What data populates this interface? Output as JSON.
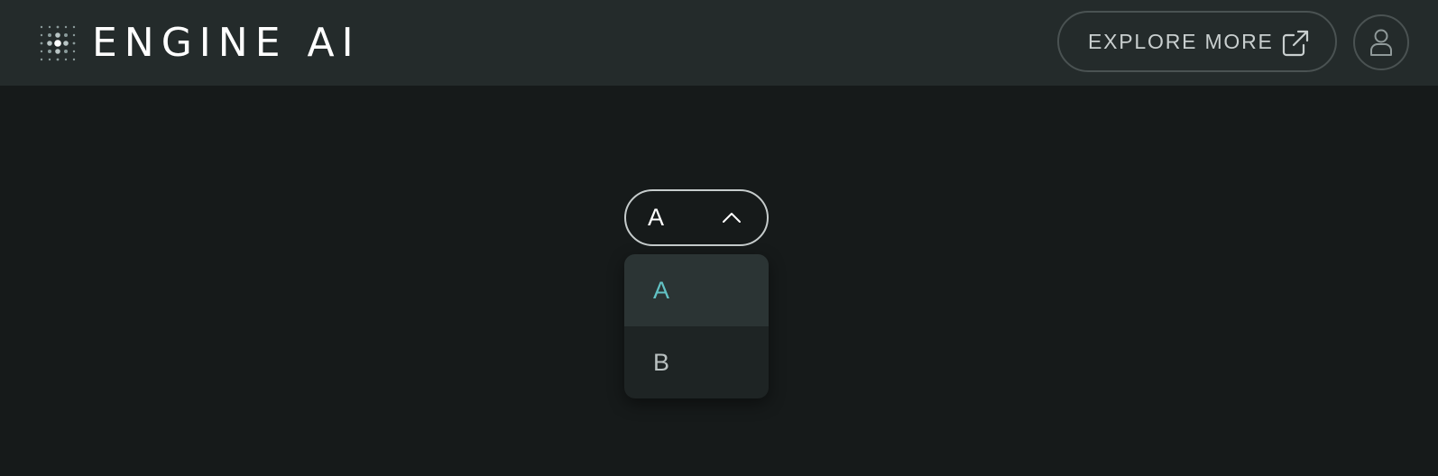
{
  "header": {
    "brand": "ENGINE AI",
    "explore_label": "EXPLORE MORE",
    "explore_icon": "external-link-icon",
    "user_icon": "user-icon",
    "logo_icon": "dot-grid-logo-icon"
  },
  "select": {
    "value": "A",
    "chevron_icon": "chevron-up-icon",
    "options": [
      {
        "label": "A",
        "selected": true
      },
      {
        "label": "B",
        "selected": false
      }
    ]
  },
  "colors": {
    "background": "#161a1a",
    "header_bg": "#242b2b",
    "accent": "#62c2c4",
    "border": "#c6cccc"
  }
}
